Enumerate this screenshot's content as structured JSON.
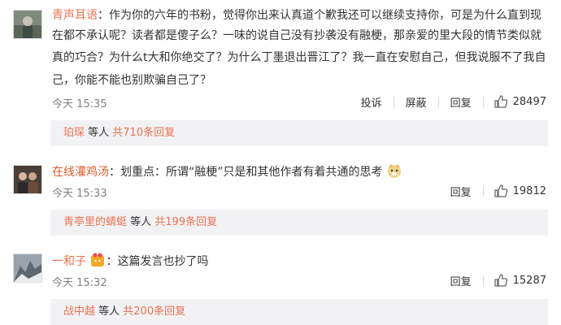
{
  "comments": [
    {
      "username": "青声耳语",
      "lines": [
        "：作为你的六年的书粉，觉得你出来认真道个歉我还可以继续支持你，可是为什么直到现",
        "在都不承认呢？读者都是傻子么？一味的说自己没有抄袭没有融梗，那亲爱的里大段的情节类似就",
        "真的巧合？为什么t大和你绝交了？为什么丁墨退出晋江了？我一直在安慰自己，但我说服不了我自",
        "己，你能不能也别欺骗自己了？"
      ],
      "time": "今天 15:35",
      "report_label": "投诉",
      "block_label": "屏蔽",
      "reply_label": "回复",
      "likes": "28497",
      "replies": {
        "nick": "珀琛",
        "suffix": " 等人 ",
        "more": "共710条回复"
      }
    },
    {
      "username": "在线灌鸡汤",
      "text": "：划重点：所谓“融梗”只是和其他作者有着共通的思考",
      "time": "今天 15:33",
      "reply_label": "回复",
      "likes": "19812",
      "replies": {
        "nick": "青亭里的蜻蜓",
        "suffix": " 等人 ",
        "more": "共199条回复"
      }
    },
    {
      "username": "一和子",
      "text": "：这篇发言也抄了吗",
      "time": "今天 15:32",
      "reply_label": "回复",
      "likes": "15287",
      "replies": {
        "nick": "战中越",
        "suffix": " 等人 ",
        "more": "共200条回复"
      }
    }
  ]
}
